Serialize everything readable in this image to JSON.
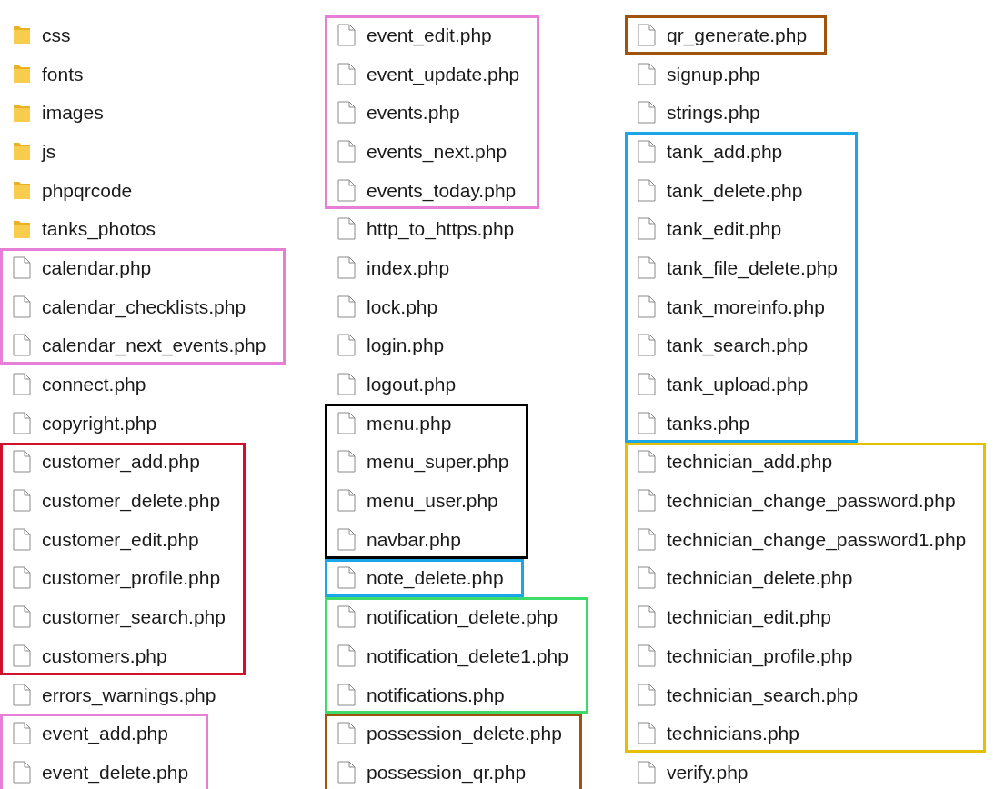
{
  "columns": [
    {
      "groups": [
        {
          "items": [
            {
              "kind": "folder",
              "name": "css"
            },
            {
              "kind": "folder",
              "name": "fonts"
            },
            {
              "kind": "folder",
              "name": "images"
            },
            {
              "kind": "folder",
              "name": "js"
            },
            {
              "kind": "folder",
              "name": "phpqrcode"
            },
            {
              "kind": "folder",
              "name": "tanks_photos"
            }
          ]
        },
        {
          "color": "#e87fd6",
          "items": [
            {
              "kind": "file",
              "name": "calendar.php"
            },
            {
              "kind": "file",
              "name": "calendar_checklists.php"
            },
            {
              "kind": "file",
              "name": "calendar_next_events.php"
            }
          ]
        },
        {
          "items": [
            {
              "kind": "file",
              "name": "connect.php"
            },
            {
              "kind": "file",
              "name": "copyright.php"
            }
          ]
        },
        {
          "color": "#d0112b",
          "items": [
            {
              "kind": "file",
              "name": "customer_add.php"
            },
            {
              "kind": "file",
              "name": "customer_delete.php"
            },
            {
              "kind": "file",
              "name": "customer_edit.php"
            },
            {
              "kind": "file",
              "name": "customer_profile.php"
            },
            {
              "kind": "file",
              "name": "customer_search.php"
            },
            {
              "kind": "file",
              "name": "customers.php"
            }
          ]
        },
        {
          "items": [
            {
              "kind": "file",
              "name": "errors_warnings.php"
            }
          ]
        },
        {
          "color": "#e87fd6",
          "items": [
            {
              "kind": "file",
              "name": "event_add.php"
            },
            {
              "kind": "file",
              "name": "event_delete.php"
            }
          ]
        }
      ]
    },
    {
      "groups": [
        {
          "color": "#e87fd6",
          "items": [
            {
              "kind": "file",
              "name": "event_edit.php"
            },
            {
              "kind": "file",
              "name": "event_update.php"
            },
            {
              "kind": "file",
              "name": "events.php"
            },
            {
              "kind": "file",
              "name": "events_next.php"
            },
            {
              "kind": "file",
              "name": "events_today.php"
            }
          ]
        },
        {
          "items": [
            {
              "kind": "file",
              "name": "http_to_https.php"
            },
            {
              "kind": "file",
              "name": "index.php"
            },
            {
              "kind": "file",
              "name": "lock.php"
            },
            {
              "kind": "file",
              "name": "login.php"
            },
            {
              "kind": "file",
              "name": "logout.php"
            }
          ]
        },
        {
          "color": "#000000",
          "items": [
            {
              "kind": "file",
              "name": "menu.php"
            },
            {
              "kind": "file",
              "name": "menu_super.php"
            },
            {
              "kind": "file",
              "name": "menu_user.php"
            },
            {
              "kind": "file",
              "name": "navbar.php"
            }
          ]
        },
        {
          "color": "#1aa7e8",
          "items": [
            {
              "kind": "file",
              "name": "note_delete.php"
            }
          ]
        },
        {
          "color": "#3ddc6a",
          "items": [
            {
              "kind": "file",
              "name": "notification_delete.php"
            },
            {
              "kind": "file",
              "name": "notification_delete1.php"
            },
            {
              "kind": "file",
              "name": "notifications.php"
            }
          ]
        },
        {
          "color": "#a0530d",
          "items": [
            {
              "kind": "file",
              "name": "possession_delete.php"
            },
            {
              "kind": "file",
              "name": "possession_qr.php"
            }
          ]
        }
      ]
    },
    {
      "groups": [
        {
          "color": "#a0530d",
          "items": [
            {
              "kind": "file",
              "name": "qr_generate.php"
            }
          ]
        },
        {
          "items": [
            {
              "kind": "file",
              "name": "signup.php"
            },
            {
              "kind": "file",
              "name": "strings.php"
            }
          ]
        },
        {
          "color": "#1aa7e8",
          "items": [
            {
              "kind": "file",
              "name": "tank_add.php"
            },
            {
              "kind": "file",
              "name": "tank_delete.php"
            },
            {
              "kind": "file",
              "name": "tank_edit.php"
            },
            {
              "kind": "file",
              "name": "tank_file_delete.php"
            },
            {
              "kind": "file",
              "name": "tank_moreinfo.php"
            },
            {
              "kind": "file",
              "name": "tank_search.php"
            },
            {
              "kind": "file",
              "name": "tank_upload.php"
            },
            {
              "kind": "file",
              "name": "tanks.php"
            }
          ]
        },
        {
          "color": "#e6c000",
          "items": [
            {
              "kind": "file",
              "name": "technician_add.php"
            },
            {
              "kind": "file",
              "name": "technician_change_password.php"
            },
            {
              "kind": "file",
              "name": "technician_change_password1.php"
            },
            {
              "kind": "file",
              "name": "technician_delete.php"
            },
            {
              "kind": "file",
              "name": "technician_edit.php"
            },
            {
              "kind": "file",
              "name": "technician_profile.php"
            },
            {
              "kind": "file",
              "name": "technician_search.php"
            },
            {
              "kind": "file",
              "name": "technicians.php"
            }
          ]
        },
        {
          "items": [
            {
              "kind": "file",
              "name": "verify.php"
            }
          ]
        }
      ]
    }
  ]
}
